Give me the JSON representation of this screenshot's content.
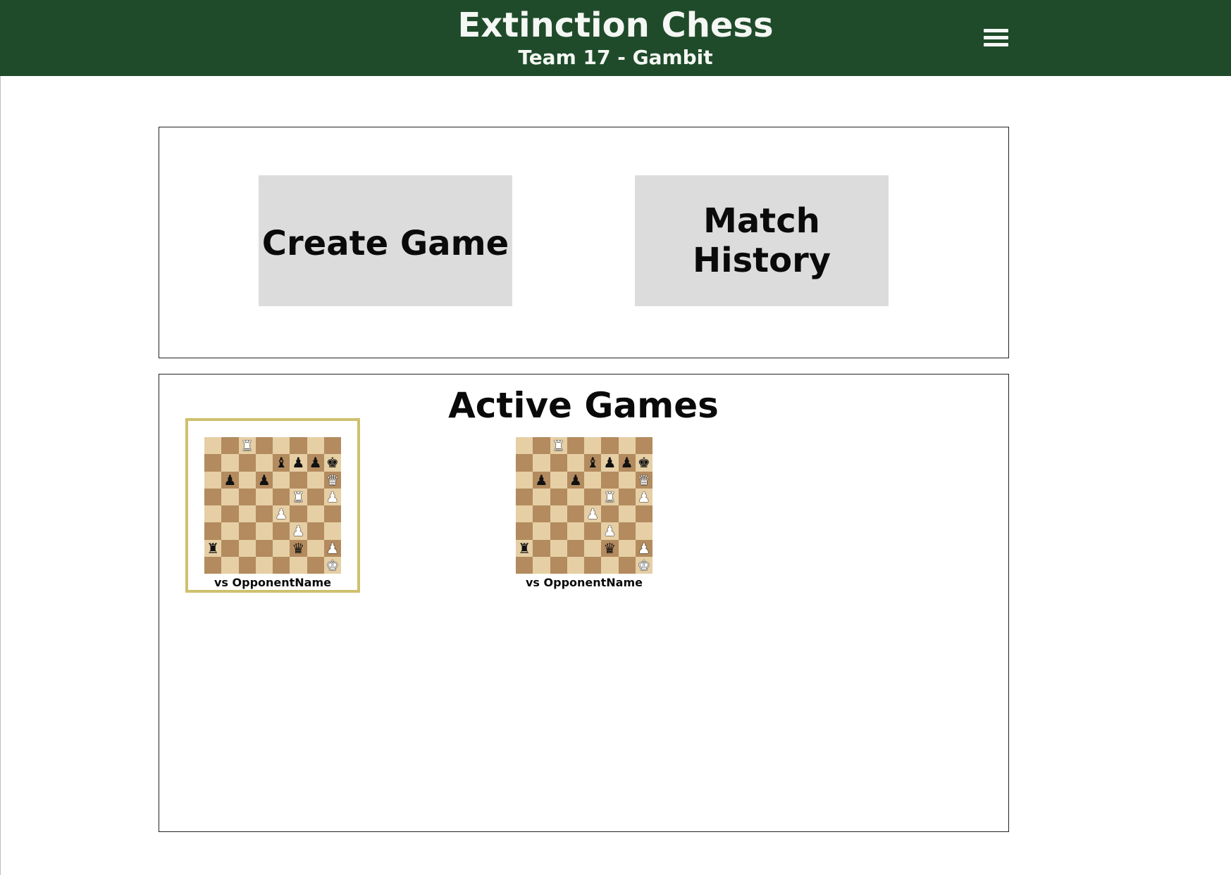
{
  "header": {
    "title": "Extinction Chess",
    "subtitle": "Team 17 - Gambit",
    "menu_icon": "hamburger-menu-icon"
  },
  "actions": {
    "create_game_label": "Create Game",
    "match_history_label": "Match History"
  },
  "active_games": {
    "title": "Active Games",
    "games": [
      {
        "opponent_label": "vs OpponentName",
        "selected": true,
        "board": [
          "..R.....",
          "....BPPK",
          ".P.P...Q",
          ".....R.P",
          "....P...",
          ".....P..",
          "R....Q.P",
          ".......K"
        ],
        "colors": [
          "..w.....",
          "....bbbb",
          ".b.b...w",
          ".....w.w",
          "....w...",
          ".....w..",
          "b....b.w",
          ".......w"
        ]
      },
      {
        "opponent_label": "vs OpponentName",
        "selected": false,
        "board": [
          "..R.....",
          "....BPPK",
          ".P.P...Q",
          ".....R.P",
          "....P...",
          ".....P..",
          "R....Q.P",
          ".......K"
        ],
        "colors": [
          "..w.....",
          "....bbbb",
          ".b.b...w",
          ".....w.w",
          "....w...",
          ".....w..",
          "b....b.w",
          ".......w"
        ]
      }
    ]
  },
  "colors": {
    "header_bg": "#1f4b2a",
    "selected_border": "#cfc06f",
    "button_bg": "#dcdcdc",
    "light_square": "#e6cfa5",
    "dark_square": "#b38b5e"
  }
}
